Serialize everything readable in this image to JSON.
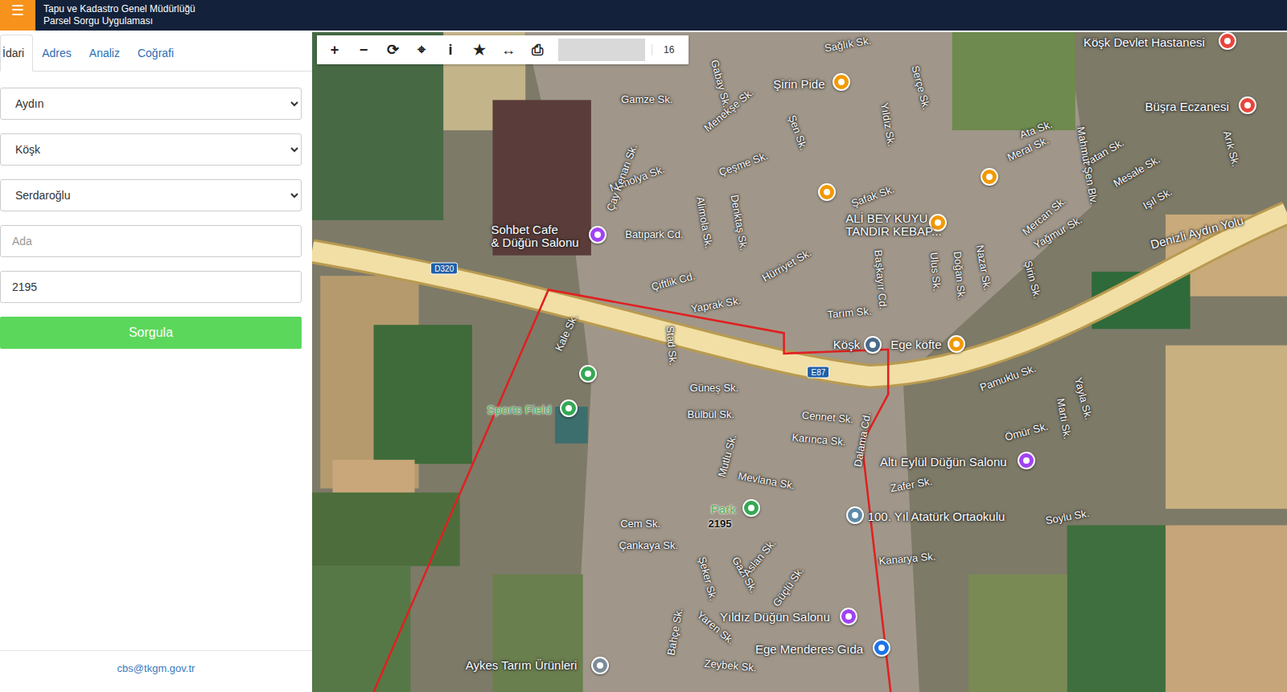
{
  "header": {
    "menu_icon": "☰",
    "title": "Tapu ve Kadastro Genel Müdürlüğü",
    "subtitle": "Parsel Sorgu Uygulaması"
  },
  "tabs": [
    {
      "label": "İdari",
      "selected": true
    },
    {
      "label": "Adres",
      "selected": false
    },
    {
      "label": "Analiz",
      "selected": false
    },
    {
      "label": "Coğrafi",
      "selected": false
    }
  ],
  "form": {
    "selects": [
      {
        "value": "Aydın"
      },
      {
        "value": "Köşk"
      },
      {
        "value": "Serdaroğlu"
      }
    ],
    "ada": {
      "placeholder": "Ada"
    },
    "parsel": {
      "value": "2195"
    },
    "button": "Sorgula"
  },
  "footer": "cbs@tkgm.gov.tr",
  "map": {
    "toolbar": [
      "+",
      "−",
      "⟳",
      "⌖",
      "i",
      "★",
      "↔",
      "⎙"
    ],
    "zoom": "16",
    "labels": [
      {
        "text": "Sağlık Sk.",
        "kind": "street"
      },
      {
        "text": "Gamze Sk.",
        "kind": "street"
      },
      {
        "text": "Menekşe Sk.",
        "kind": "street"
      },
      {
        "text": "Çeşme Sk.",
        "kind": "street"
      },
      {
        "text": "Manolya Sk.",
        "kind": "street"
      },
      {
        "text": "Şafak Sk.",
        "kind": "street"
      },
      {
        "text": "Ata Sk.",
        "kind": "street"
      },
      {
        "text": "Meral Sk.",
        "kind": "street"
      },
      {
        "text": "Vatan Sk.",
        "kind": "street"
      },
      {
        "text": "Mesale Sk.",
        "kind": "street"
      },
      {
        "text": "Işıl Sk.",
        "kind": "street"
      },
      {
        "text": "Mercan Sk.",
        "kind": "street"
      },
      {
        "text": "Yağmur Sk.",
        "kind": "street"
      },
      {
        "text": "Batıpark Cd.",
        "kind": "street"
      },
      {
        "text": "Çiftlik Cd.",
        "kind": "street"
      },
      {
        "text": "Hürriyet Sk.",
        "kind": "street"
      },
      {
        "text": "Yaprak Sk.",
        "kind": "street"
      },
      {
        "text": "Tarım Sk.",
        "kind": "street"
      },
      {
        "text": "Pamuklu Sk.",
        "kind": "street"
      },
      {
        "text": "Güneş Sk.",
        "kind": "street"
      },
      {
        "text": "Bülbül Sk.",
        "kind": "street"
      },
      {
        "text": "Cennet Sk.",
        "kind": "street"
      },
      {
        "text": "Karınca Sk.",
        "kind": "street"
      },
      {
        "text": "Ömür Sk.",
        "kind": "street"
      },
      {
        "text": "Zafer Sk.",
        "kind": "street"
      },
      {
        "text": "Mevlana Sk.",
        "kind": "street"
      },
      {
        "text": "Soylu Sk.",
        "kind": "street"
      },
      {
        "text": "Cem Sk.",
        "kind": "street"
      },
      {
        "text": "Çankaya Sk.",
        "kind": "street"
      },
      {
        "text": "Kanarya Sk.",
        "kind": "street"
      },
      {
        "text": "Zeybek Sk.",
        "kind": "street"
      },
      {
        "text": "Gabay Sk.",
        "kind": "street"
      },
      {
        "text": "Yıldız Sk.",
        "kind": "street"
      },
      {
        "text": "Serçe Sk.",
        "kind": "street"
      },
      {
        "text": "Şen Sk.",
        "kind": "street"
      },
      {
        "text": "Alimola Sk.",
        "kind": "street"
      },
      {
        "text": "Denktaş Sk.",
        "kind": "street"
      },
      {
        "text": "Çay Kenarı Sk.",
        "kind": "street"
      },
      {
        "text": "Başkayır Cd.",
        "kind": "street"
      },
      {
        "text": "Ulus Sk.",
        "kind": "street"
      },
      {
        "text": "Doğan Sk.",
        "kind": "street"
      },
      {
        "text": "Nazar Sk.",
        "kind": "street"
      },
      {
        "text": "Şirin Sk.",
        "kind": "street"
      },
      {
        "text": "Mahmut Şen Blv.",
        "kind": "street"
      },
      {
        "text": "Arık Sk.",
        "kind": "street"
      },
      {
        "text": "Stad Sk.",
        "kind": "street"
      },
      {
        "text": "Kale Sk.",
        "kind": "street"
      },
      {
        "text": "Dalama Cd.",
        "kind": "street"
      },
      {
        "text": "Mutlu Sk.",
        "kind": "street"
      },
      {
        "text": "Gazi Sk.",
        "kind": "street"
      },
      {
        "text": "Aslan Sk.",
        "kind": "street"
      },
      {
        "text": "Güçlü Sk.",
        "kind": "street"
      },
      {
        "text": "Şeker Sk.",
        "kind": "street"
      },
      {
        "text": "Bahçe Sk.",
        "kind": "street"
      },
      {
        "text": "Yaren Sk.",
        "kind": "street"
      },
      {
        "text": "Yayla Sk.",
        "kind": "street"
      },
      {
        "text": "Marti Sk.",
        "kind": "street"
      },
      {
        "text": "Denizli Aydın Yolu",
        "kind": "road"
      },
      {
        "text": "D320",
        "kind": "shield"
      },
      {
        "text": "E87",
        "kind": "shield"
      },
      {
        "text": "2195",
        "kind": "parcel"
      }
    ],
    "places": [
      {
        "lines": [
          "Köşk Devlet Hastanesi"
        ],
        "kind": "poi",
        "color": "#e8453c"
      },
      {
        "lines": [
          "Şirin Pide"
        ],
        "kind": "poi",
        "color": "#f29900"
      },
      {
        "lines": [
          "Büşra Eczanesi"
        ],
        "kind": "poi",
        "color": "#e8453c"
      },
      {
        "lines": [
          "ALİ BEY KUYU",
          "TANDIR KEBAP..."
        ],
        "kind": "poi",
        "color": "#f29900"
      },
      {
        "lines": [
          "Sohbet Cafe",
          "& Düğün Salonu"
        ],
        "kind": "poi",
        "color": "#a142f4"
      },
      {
        "lines": [
          "Köşk"
        ],
        "kind": "poi",
        "color": "#4a6a8a"
      },
      {
        "lines": [
          "Ege köfte"
        ],
        "kind": "poi",
        "color": "#f29900"
      },
      {
        "lines": [
          "Sports Field"
        ],
        "kind": "park",
        "color": "#34a853"
      },
      {
        "lines": [
          "Altı Eylül Düğün Salonu"
        ],
        "kind": "poi",
        "color": "#a142f4"
      },
      {
        "lines": [
          "Park"
        ],
        "kind": "park",
        "color": "#34a853"
      },
      {
        "lines": [
          "100. Yıl Atatürk Ortaokulu"
        ],
        "kind": "poi",
        "color": "#5f8aa8"
      },
      {
        "lines": [
          "Yıldız Düğün Salonu"
        ],
        "kind": "poi",
        "color": "#a142f4"
      },
      {
        "lines": [
          "Ege Menderes Gıda"
        ],
        "kind": "poi",
        "color": "#1a73e8"
      },
      {
        "lines": [
          "Aykes Tarım Ürünleri"
        ],
        "kind": "poi",
        "color": "#7b8b99"
      },
      {
        "lines": [],
        "kind": "poi",
        "color": "#f29900"
      },
      {
        "lines": [],
        "kind": "poi",
        "color": "#f29900"
      },
      {
        "lines": [],
        "kind": "park",
        "color": "#34a853"
      }
    ]
  }
}
